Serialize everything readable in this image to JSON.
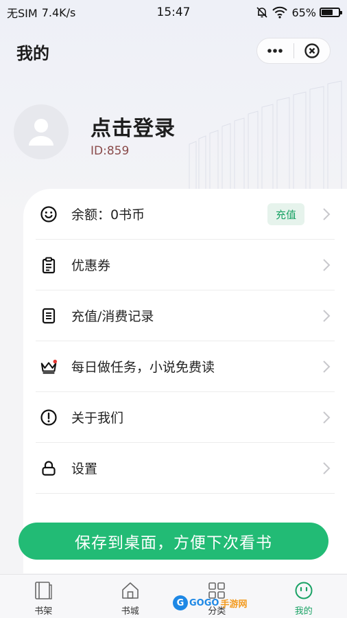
{
  "status_bar": {
    "carrier": "无SIM",
    "speed": "7.4K/s",
    "time": "15:47",
    "battery": "65%",
    "battery_level": 0.65,
    "icons": [
      "mute-bell-icon",
      "wifi-icon",
      "battery-icon"
    ]
  },
  "header": {
    "title": "我的",
    "capsule": {
      "more_icon": "more-dots-icon",
      "close_icon": "close-circle-icon"
    }
  },
  "profile": {
    "login_text": "点击登录",
    "user_id": "ID:859",
    "avatar_icon": "default-user-icon"
  },
  "menu": {
    "items": [
      {
        "label": "余额：0书币",
        "icon": "smile-icon",
        "badge": "充值"
      },
      {
        "label": "优惠券",
        "icon": "clipboard-icon"
      },
      {
        "label": "充值/消费记录",
        "icon": "document-list-icon"
      },
      {
        "label": "每日做任务，小说免费读",
        "icon": "crown-icon"
      },
      {
        "label": "关于我们",
        "icon": "info-exclamation-icon"
      },
      {
        "label": "设置",
        "icon": "lock-icon"
      }
    ]
  },
  "save_button": {
    "label": "保存到桌面，方便下次看书"
  },
  "tab_bar": {
    "tabs": [
      {
        "label": "书架",
        "icon": "bookshelf-icon",
        "active": false
      },
      {
        "label": "书城",
        "icon": "home-icon",
        "active": false
      },
      {
        "label": "分类",
        "icon": "grid-icon",
        "active": false
      },
      {
        "label": "我的",
        "icon": "smile-face-tab-icon",
        "active": true
      }
    ]
  },
  "watermark": {
    "text1": "GOGO",
    "text2": "手游网"
  },
  "colors": {
    "accent": "#22bb75",
    "accent_text": "#1aa265",
    "badge_bg": "#e6f3ec",
    "id_color": "#8a4a4a"
  }
}
